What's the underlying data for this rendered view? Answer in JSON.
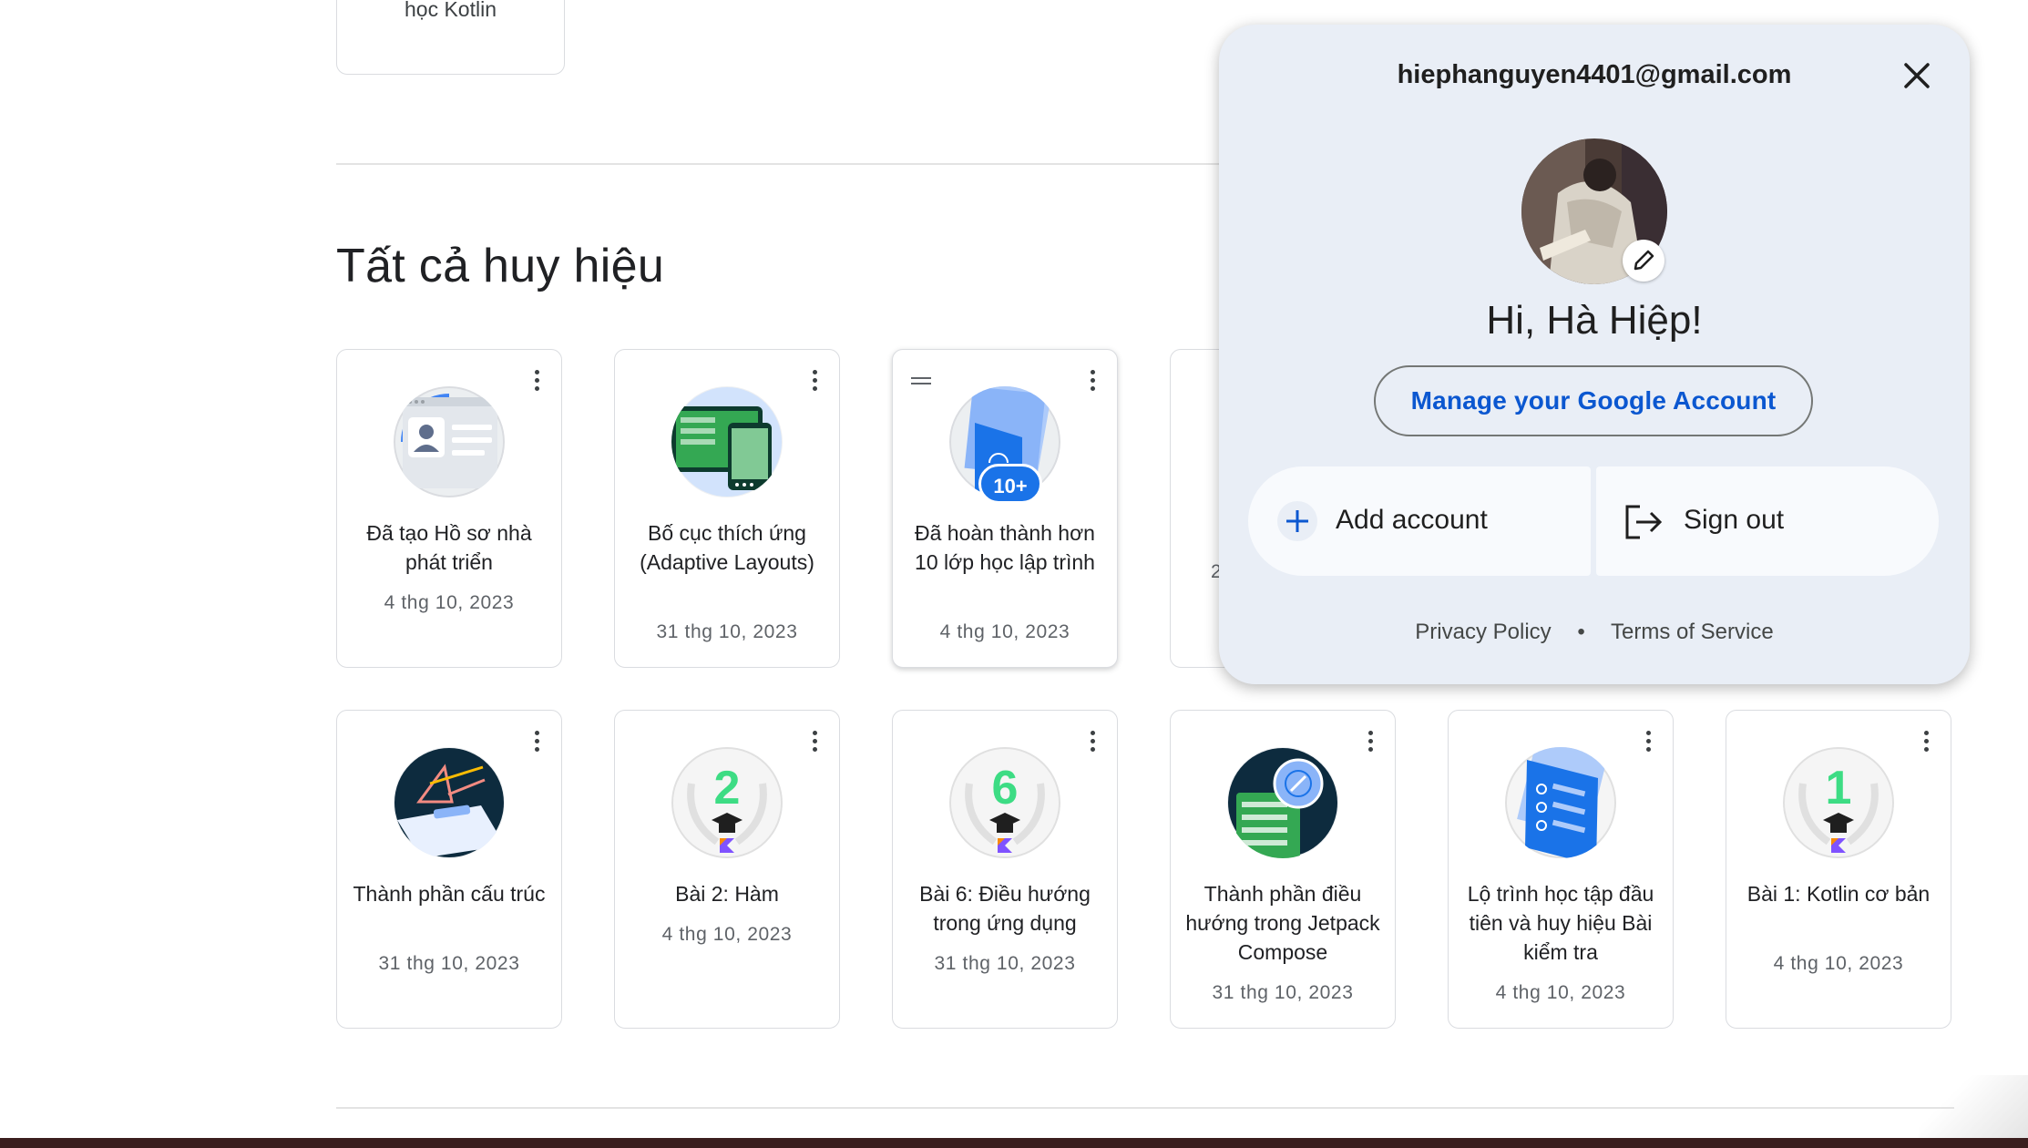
{
  "top_card": {
    "label": "học Kotlin"
  },
  "section": {
    "title": "Tất cả huy hiệu"
  },
  "badges_row1": [
    {
      "name": "Đã tạo Hồ sơ nhà phát triển",
      "date": "4 thg 10, 2023"
    },
    {
      "name": "Bố cục thích ứng (Adaptive Layouts)",
      "date": "31 thg 10, 2023"
    },
    {
      "name": "Đã hoàn thành hơn 10 lớp học lập trình",
      "date": "4 thg 10, 2023",
      "count_label": "10+"
    },
    {
      "name": "",
      "date": "2"
    }
  ],
  "badges_row2": [
    {
      "name": "Thành phần cấu trúc",
      "date": "31 thg 10, 2023"
    },
    {
      "name": "Bài 2: Hàm",
      "date": "4 thg 10, 2023",
      "number": "2"
    },
    {
      "name": "Bài 6: Điều hướng trong ứng dụng",
      "date": "31 thg 10, 2023",
      "number": "6"
    },
    {
      "name": "Thành phần điều hướng trong Jetpack Compose",
      "date": "31 thg 10, 2023"
    },
    {
      "name": "Lộ trình học tập đầu tiên và huy hiệu Bài kiểm tra",
      "date": "4 thg 10, 2023"
    },
    {
      "name": "Bài 1: Kotlin cơ bản",
      "date": "4 thg 10, 2023",
      "number": "1"
    }
  ],
  "account_popup": {
    "email": "hiephanguyen4401@gmail.com",
    "greeting": "Hi, Hà Hiệp!",
    "manage_label": "Manage your Google Account",
    "add_account_label": "Add account",
    "sign_out_label": "Sign out",
    "privacy_label": "Privacy Policy",
    "separator": "•",
    "terms_label": "Terms of Service"
  },
  "colors": {
    "accent_blue": "#0b57d0",
    "popup_bg": "#e9eef6",
    "kotlin_green": "#3ddc84"
  }
}
